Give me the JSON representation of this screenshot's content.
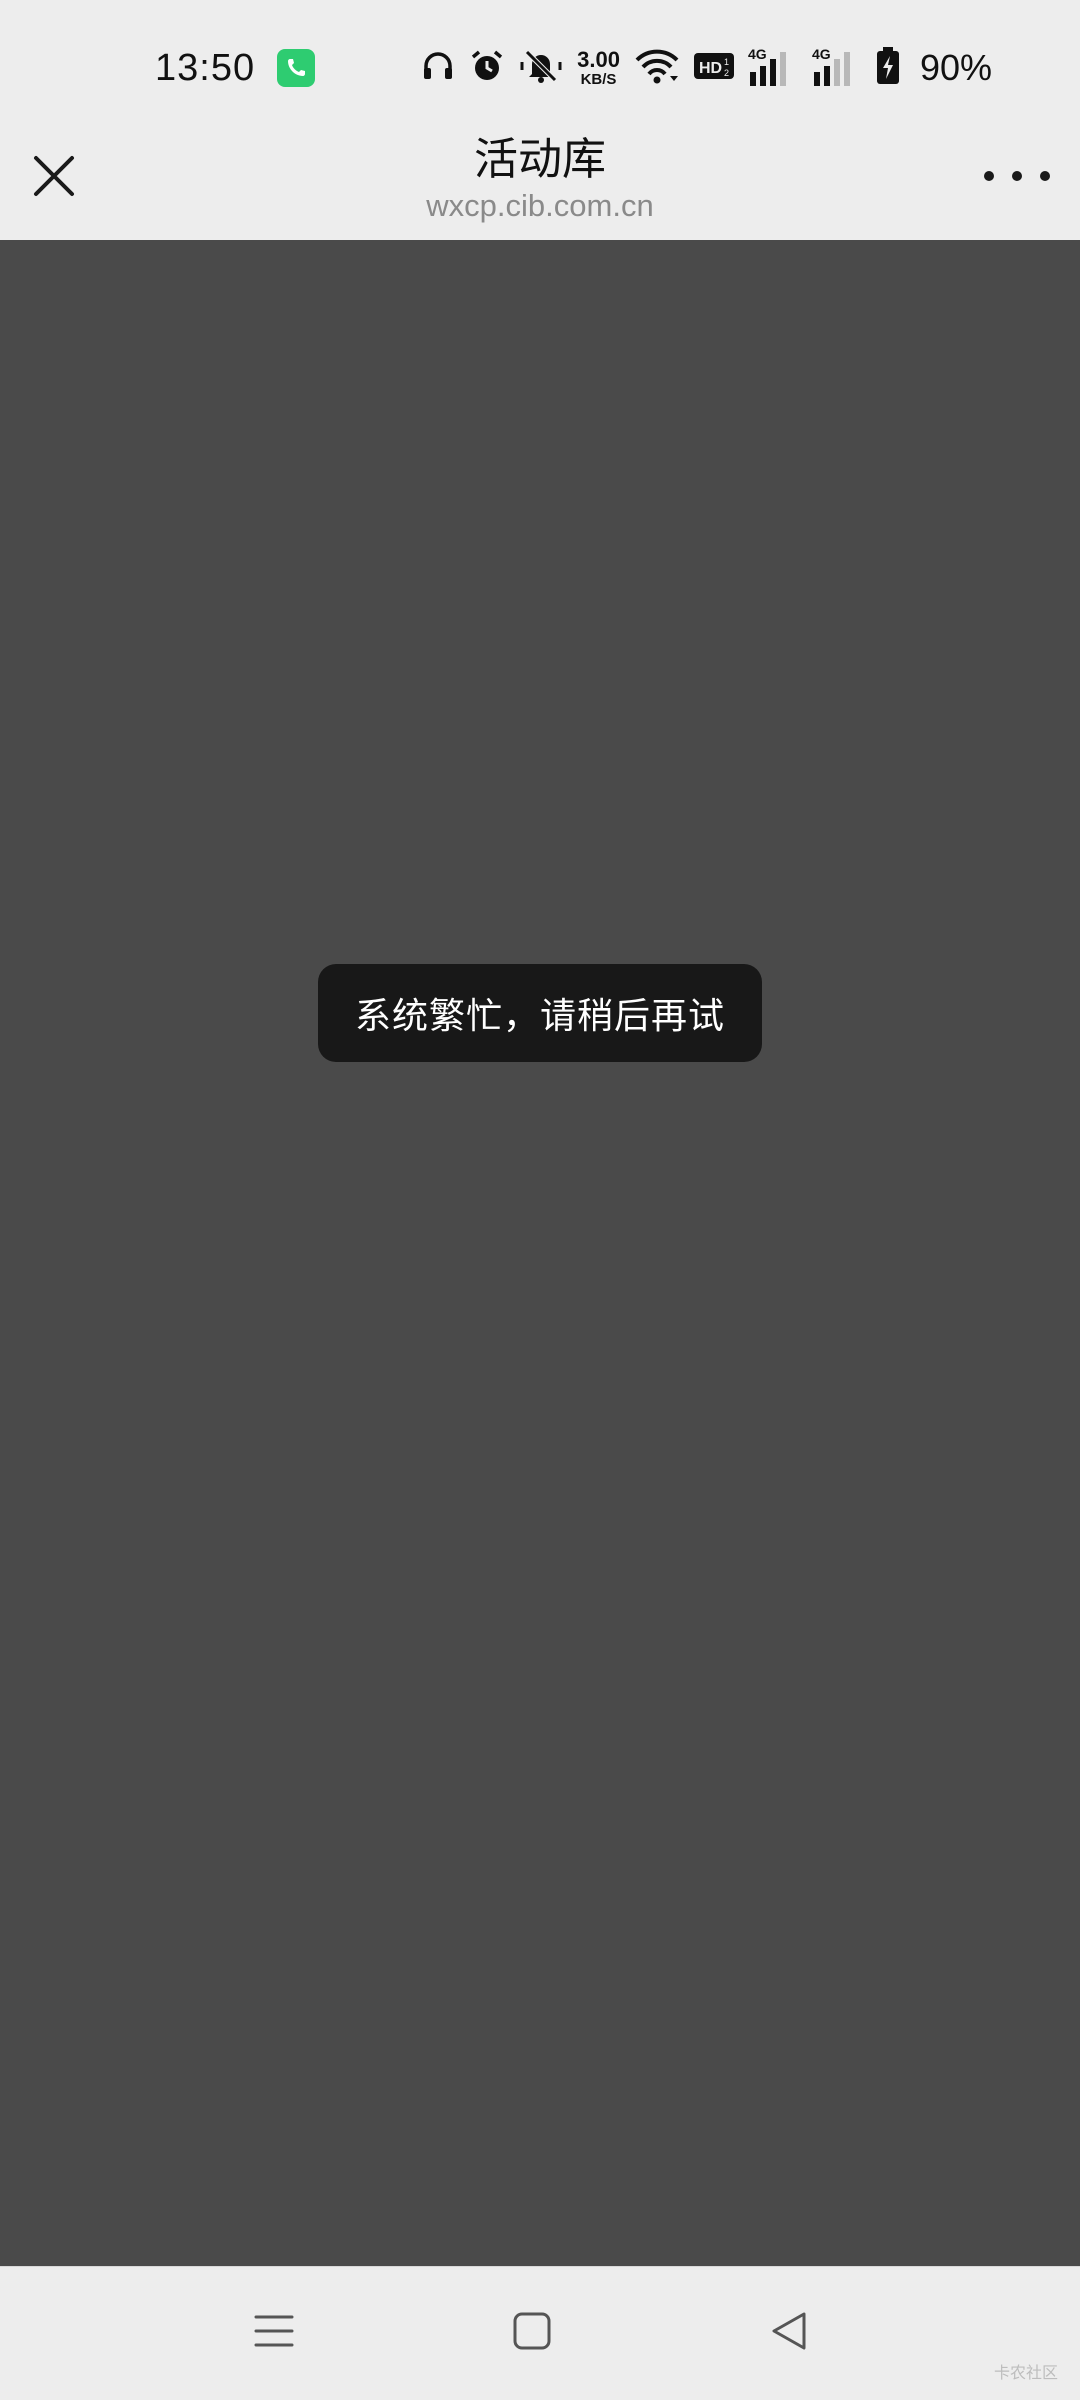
{
  "status_bar": {
    "time": "13:50",
    "net_speed_value": "3.00",
    "net_speed_unit": "KB/S",
    "network_label_1": "4G",
    "network_label_2": "4G",
    "battery": "90%",
    "icons": [
      "phone-call-icon",
      "headphones-icon",
      "alarm-icon",
      "muted-bell-icon",
      "wifi-icon",
      "hd-icon",
      "signal-icon",
      "battery-charging-icon"
    ]
  },
  "title_bar": {
    "title": "活动库",
    "subtitle": "wxcp.cib.com.cn",
    "close_icon": "close-icon",
    "more_icon": "more-icon"
  },
  "toast": {
    "message": "系统繁忙，请稍后再试"
  },
  "bottom_nav": {
    "icons": [
      "menu-icon",
      "home-icon",
      "back-icon"
    ]
  },
  "watermark": {
    "text": "卡农社区"
  },
  "colors": {
    "bar_bg": "#ededed",
    "content_bg": "#4a4a4a",
    "toast_bg": "#181818",
    "call_green": "#2ecc71"
  }
}
